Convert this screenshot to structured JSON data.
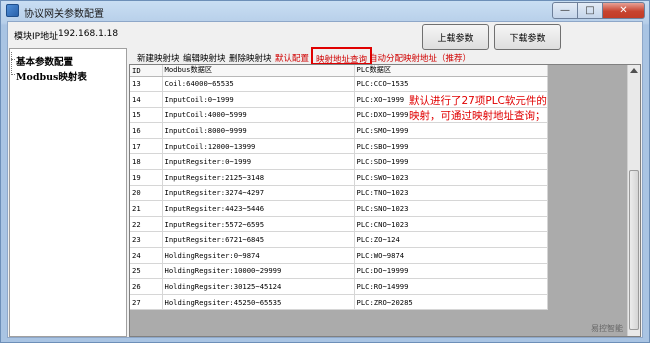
{
  "window": {
    "title": "协议网关参数配置",
    "buttons": {
      "minimize": "—",
      "maximize": "□",
      "close": "✕"
    }
  },
  "top": {
    "ip_label": "模块IP地址",
    "ip_value": "192.168.1.18",
    "upload_label": "上载参数",
    "download_label": "下载参数"
  },
  "tree": {
    "items": [
      "基本参数配置",
      "Modbus映射表"
    ]
  },
  "toolbar": {
    "new_label": "新建映射块",
    "edit_label": "编辑映射块",
    "delete_label": "删除映射块",
    "default_label": "默认配置",
    "query_label": "映射地址查询",
    "auto_label": "自动分配映射地址（推荐）"
  },
  "table": {
    "headers": [
      "ID",
      "Modbus数据区",
      "PLC数据区"
    ],
    "rows": [
      [
        "13",
        "Coil:64000~65535",
        "PLC:CCO~1535"
      ],
      [
        "14",
        "InputCoil:0~1999",
        "PLC:XO~1999"
      ],
      [
        "15",
        "InputCoil:4000~5999",
        "PLC:DXO~1999"
      ],
      [
        "16",
        "InputCoil:8000~9999",
        "PLC:SMO~1999"
      ],
      [
        "17",
        "InputCoil:12000~13999",
        "PLC:SBO~1999"
      ],
      [
        "18",
        "InputRegsiter:0~1999",
        "PLC:SDO~1999"
      ],
      [
        "19",
        "InputRegsiter:2125~3148",
        "PLC:SWO~1023"
      ],
      [
        "20",
        "InputRegsiter:3274~4297",
        "PLC:TNO~1023"
      ],
      [
        "21",
        "InputRegsiter:4423~5446",
        "PLC:SNO~1023"
      ],
      [
        "22",
        "InputRegsiter:5572~6595",
        "PLC:CNO~1023"
      ],
      [
        "23",
        "InputRegsiter:6721~6845",
        "PLC:ZO~124"
      ],
      [
        "24",
        "HoldingRegsiter:0~9874",
        "PLC:WO~9874"
      ],
      [
        "25",
        "HoldingRegsiter:10000~29999",
        "PLC:DO~19999"
      ],
      [
        "26",
        "HoldingRegsiter:30125~45124",
        "PLC:RO~14999"
      ],
      [
        "27",
        "HoldingRegsiter:45250~65535",
        "PLC:ZRO~20285"
      ]
    ]
  },
  "annotation": "默认进行了27项PLC软元件的映射，可通过映射地址查询；",
  "watermark": "易控智能",
  "colors": {
    "accent_red": "#e00000",
    "title_bar": "#b7cfe9"
  }
}
